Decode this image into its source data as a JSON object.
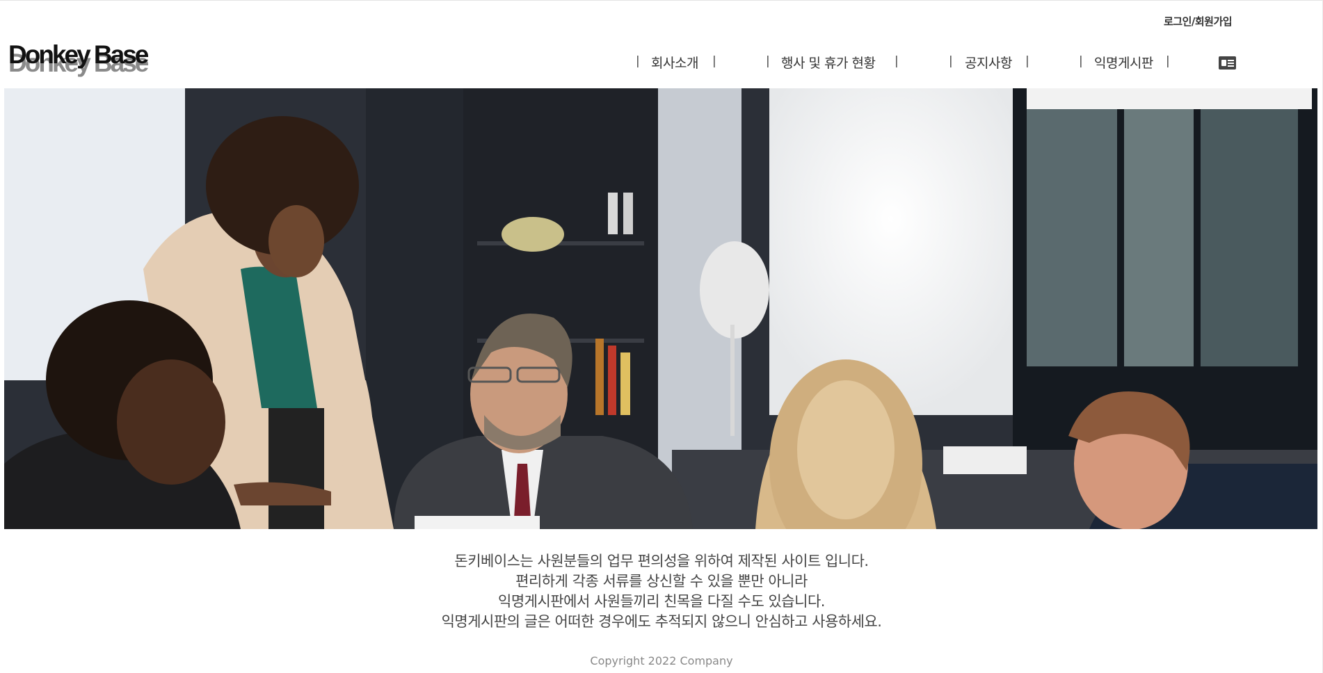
{
  "header": {
    "auth_link": "로그인/회원가입",
    "logo_text": "Donkey Base"
  },
  "nav": {
    "items": [
      {
        "label": "회사소개"
      },
      {
        "label": "행사 및 휴가 현황"
      },
      {
        "label": "공지사항"
      },
      {
        "label": "익명게시판"
      }
    ],
    "separator": "|",
    "profile_icon": "id-card-icon"
  },
  "hero": {
    "image": "office-meeting-photo"
  },
  "intro": {
    "lines": [
      "돈키베이스는 사원분들의 업무 편의성을 위하여 제작된 사이트 입니다.",
      "편리하게 각종 서류를 상신할 수 있을 뿐만 아니라",
      "익명게시판에서 사원들끼리 친목을 다질 수도 있습니다.",
      "익명게시판의 글은 어떠한 경우에도 추적되지 않으니 안심하고 사용하세요."
    ]
  },
  "footer": {
    "copyright": "Copyright 2022 Company"
  }
}
